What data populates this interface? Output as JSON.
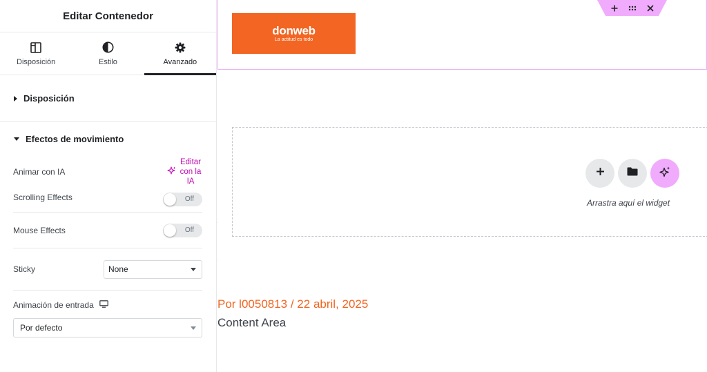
{
  "panel": {
    "title": "Editar Contenedor",
    "tabs": [
      {
        "label": "Disposición",
        "icon": "layout-icon",
        "active": false
      },
      {
        "label": "Estilo",
        "icon": "half-circle-icon",
        "active": false
      },
      {
        "label": "Avanzado",
        "icon": "gear-icon",
        "active": true
      }
    ],
    "sections": {
      "layout": {
        "title": "Disposición",
        "expanded": false
      },
      "motion": {
        "title": "Efectos de movimiento",
        "expanded": true,
        "animate_ai": {
          "label": "Animar con IA",
          "link": "Editar con la IA"
        },
        "scrolling": {
          "label": "Scrolling Effects",
          "state": "Off"
        },
        "mouse": {
          "label": "Mouse Effects",
          "state": "Off"
        },
        "sticky": {
          "label": "Sticky",
          "value": "None"
        },
        "entrance": {
          "label": "Animación de entrada",
          "icon": "desktop-icon",
          "value": "Por defecto"
        }
      }
    }
  },
  "canvas": {
    "logo": {
      "brand": "donweb",
      "tagline": "La actitud es todo"
    },
    "container_handle": {
      "icons": [
        "plus-icon",
        "drag-handle-icon",
        "close-icon"
      ]
    },
    "drop_zone": {
      "text": "Arrastra aquí el widget"
    },
    "post_meta": "Por l0050813 / 22 abril, 2025",
    "content_area": "Content Area"
  },
  "colors": {
    "accent_pink": "#f0abfc",
    "ai_magenta": "#c00bb3",
    "brand_orange": "#f26522",
    "panel_text": "#1f2124"
  }
}
